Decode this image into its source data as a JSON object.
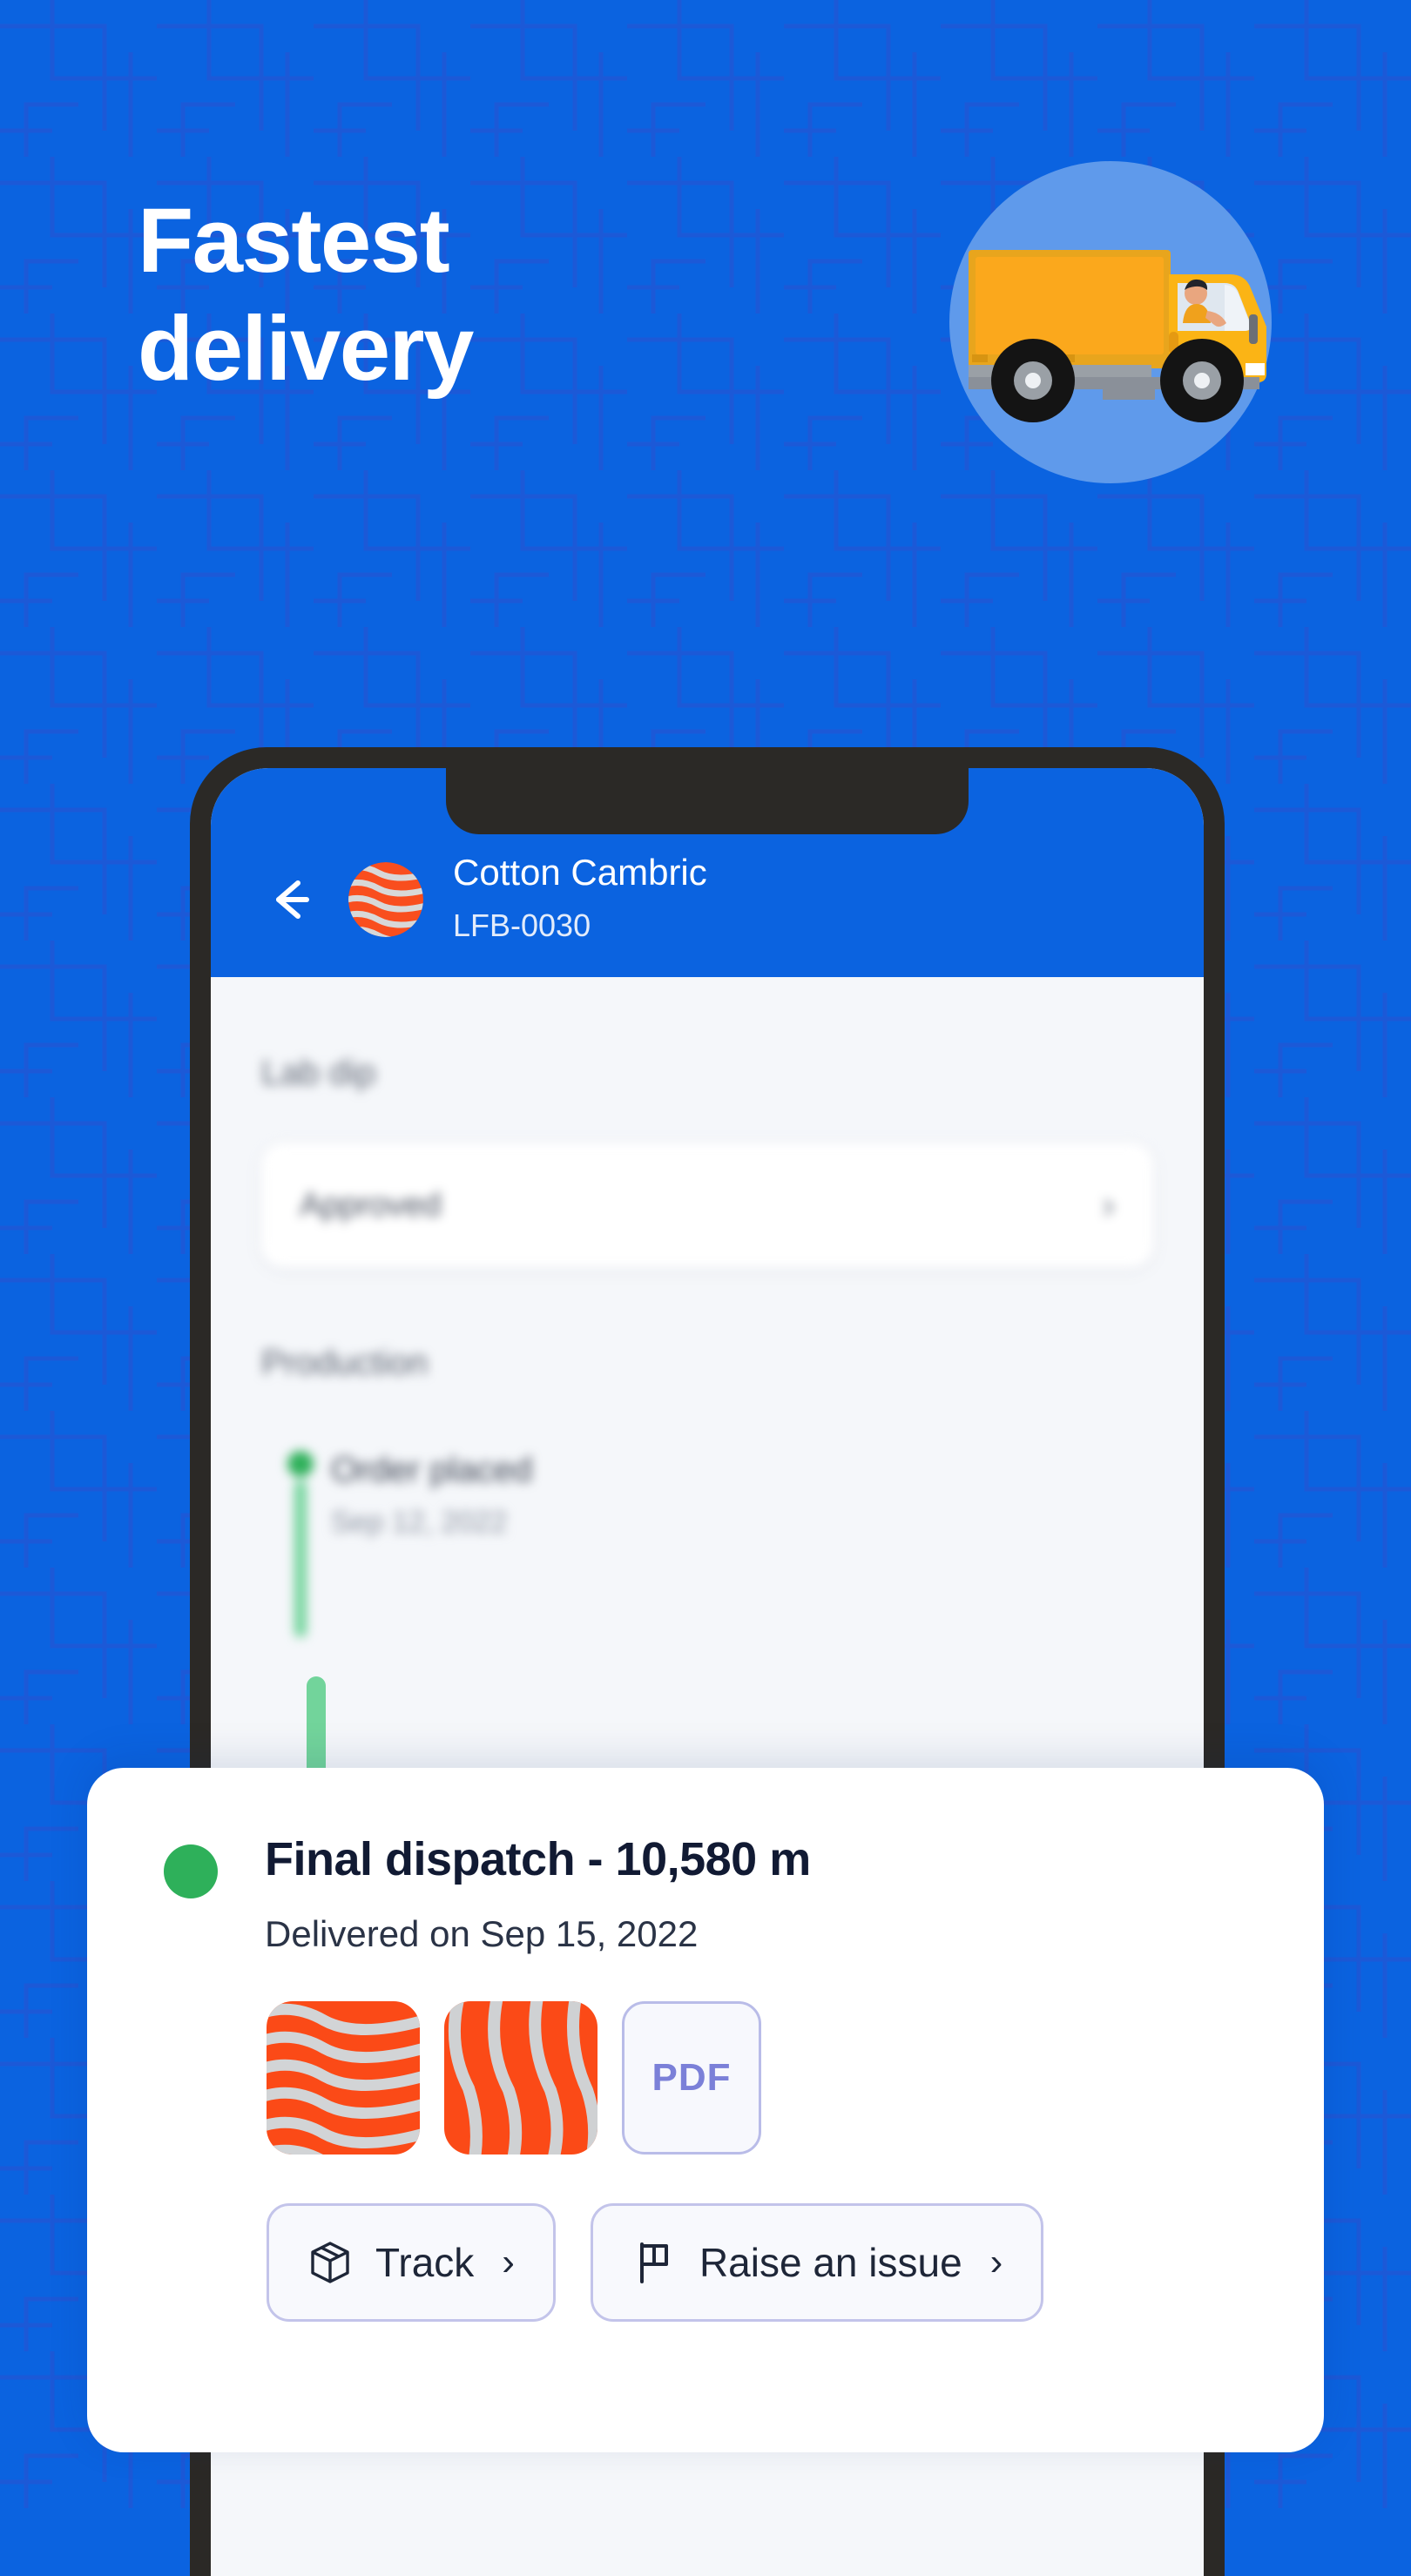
{
  "theme": {
    "background_blue": "#0b63e0",
    "pattern_line_blue": "#2a50cf",
    "accent_orange": "#f94e1e",
    "status_green": "#2eb05a",
    "timeline_green": "#72d49b",
    "pdf_purple": "#7b80d8",
    "phone_bezel": "#2b2926"
  },
  "hero": {
    "headline": "Fastest\ndelivery",
    "illustration": "delivery-truck-icon"
  },
  "app": {
    "header": {
      "back_icon": "arrow-left-icon",
      "avatar": "fabric-swatch-avatar",
      "title": "Cotton Cambric",
      "subtitle": "LFB-0030"
    },
    "sections": {
      "lab_dip": {
        "label": "Lab dip",
        "value": "Approved",
        "chevron": "chevron-right-icon"
      },
      "production": {
        "label": "Production",
        "events": [
          {
            "title": "Order placed",
            "date": "Sep 12, 2022"
          }
        ]
      }
    },
    "sheet": {
      "title": "Final dispatch - 10,580 m",
      "subtitle": "Delivered on Sep 15, 2022",
      "attachments": [
        {
          "type": "image",
          "name": "fabric-swatch-thumbnail-1"
        },
        {
          "type": "image",
          "name": "fabric-swatch-thumbnail-2"
        },
        {
          "type": "file",
          "name": "pdf-attachment",
          "label": "PDF"
        }
      ],
      "actions": [
        {
          "icon": "package-box-icon",
          "label": "Track",
          "chevron": "›"
        },
        {
          "icon": "flag-icon",
          "label": "Raise an issue",
          "chevron": "›"
        }
      ]
    }
  }
}
